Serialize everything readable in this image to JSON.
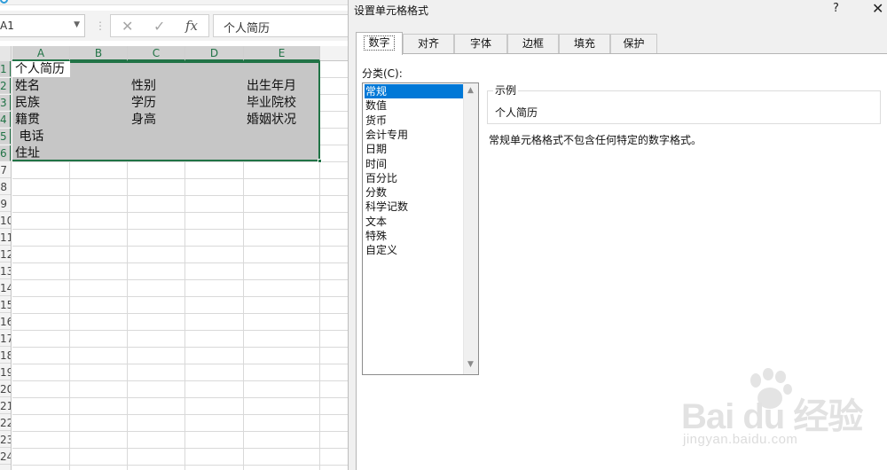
{
  "sheet": {
    "name_box": "A1",
    "formula_bar_buttons": {
      "cancel_icon": "close-icon",
      "enter_icon": "check-icon",
      "function_label": "fx"
    },
    "formula_value": "个人简历",
    "columns": [
      "A",
      "B",
      "C",
      "D",
      "E"
    ],
    "rows": [
      "1",
      "2",
      "3",
      "4",
      "5",
      "6",
      "7",
      "8",
      "9",
      "10",
      "11",
      "12",
      "13",
      "14",
      "15",
      "16",
      "17",
      "18",
      "19",
      "20",
      "21",
      "22",
      "23",
      "24"
    ],
    "cells": {
      "A1": "个人简历",
      "A2": "姓名",
      "C2": "性别",
      "E2": "出生年月",
      "A3": "民族",
      "C3": "学历",
      "E3": "毕业院校",
      "A4": "籍贯",
      "C4": "身高",
      "E4": "婚姻状况",
      "A5": " 电话",
      "A6": "住址"
    },
    "selection_range": "A1:E6",
    "accent_color": "#217346"
  },
  "dialog": {
    "title": "设置单元格格式",
    "help": "?",
    "close": "✕",
    "tabs": [
      "数字",
      "对齐",
      "字体",
      "边框",
      "填充",
      "保护"
    ],
    "active_tab": "数字",
    "category_label": "分类(C):",
    "categories": [
      "常规",
      "数值",
      "货币",
      "会计专用",
      "日期",
      "时间",
      "百分比",
      "分数",
      "科学记数",
      "文本",
      "特殊",
      "自定义"
    ],
    "selected_category": "常规",
    "sample_label": "示例",
    "sample_value": "个人简历",
    "description": "常规单元格格式不包含任何特定的数字格式。",
    "selection_color": "#0078d7"
  },
  "watermark": {
    "logo": "Bai du 经验",
    "url": "jingyan.baidu.com"
  }
}
